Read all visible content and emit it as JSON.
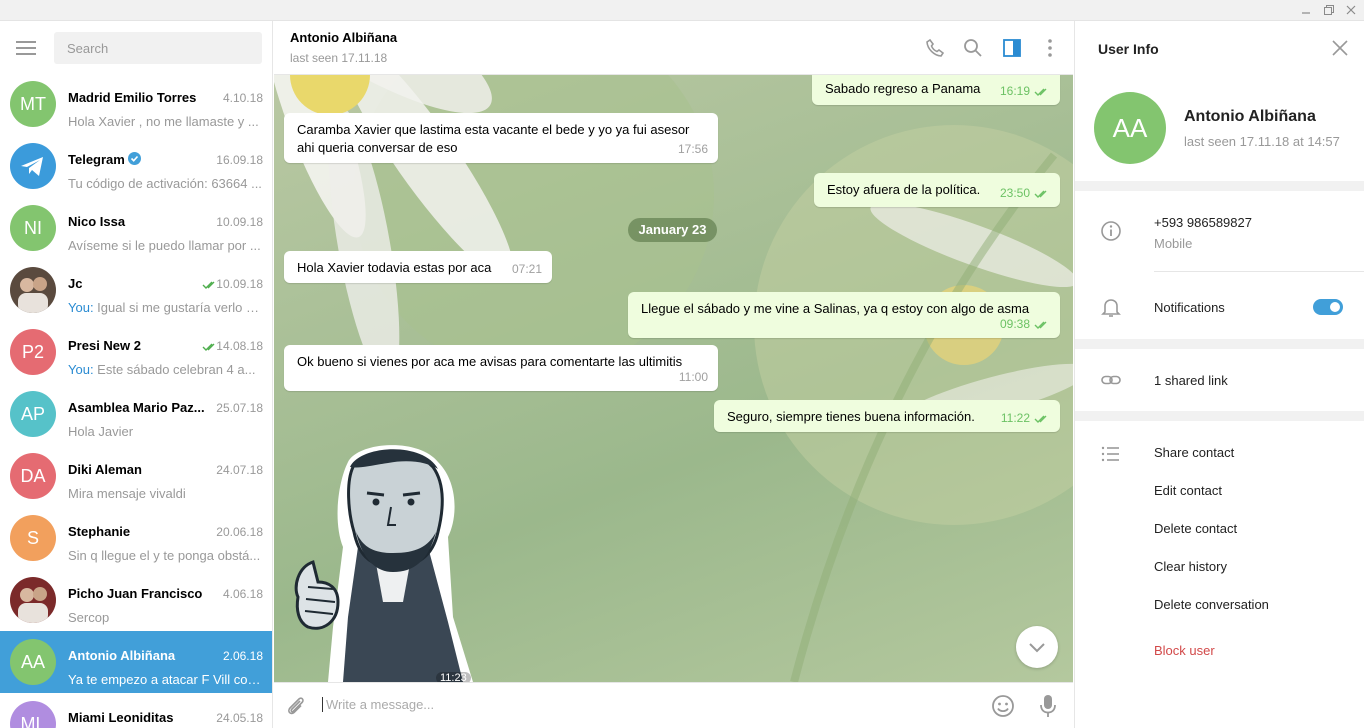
{
  "window": {
    "minimize_icon": "minimize-icon",
    "maximize_icon": "restore-icon",
    "close_icon": "close-icon"
  },
  "sidebar": {
    "search_placeholder": "Search",
    "chats": [
      {
        "initials": "MT",
        "color": "#83c56f",
        "name": "Madrid Emilio Torres",
        "date": "4.10.18",
        "preview": "Hola Xavier , no me llamaste y ...",
        "you": ""
      },
      {
        "initials": "",
        "color": "#3b9bdb",
        "name": "Telegram",
        "verified": true,
        "date": "16.09.18",
        "preview": "Tu código de activación: 63664 ...",
        "you": ""
      },
      {
        "initials": "NI",
        "color": "#83c56f",
        "name": "Nico Issa",
        "date": "10.09.18",
        "preview": "Avíseme si le puedo llamar por ...",
        "you": ""
      },
      {
        "initials": "",
        "color": "#5a4a3e",
        "name": "Jc",
        "date": "10.09.18",
        "read": true,
        "preview": "Igual si me gustaría verlo s...",
        "you": "You: "
      },
      {
        "initials": "P2",
        "color": "#e56b72",
        "name": "Presi New 2",
        "date": "14.08.18",
        "read": true,
        "preview": "Este sábado celebran 4 a...",
        "you": "You: "
      },
      {
        "initials": "AP",
        "color": "#56c2c9",
        "name": "Asamblea Mario Paz...",
        "date": "25.07.18",
        "preview": "Hola Javier",
        "you": ""
      },
      {
        "initials": "DA",
        "color": "#e56b72",
        "name": "Diki Aleman",
        "date": "24.07.18",
        "preview": "Mira mensaje vivaldi",
        "you": ""
      },
      {
        "initials": "S",
        "color": "#f2a05d",
        "name": "Stephanie",
        "date": "20.06.18",
        "preview": "Sin q llegue el y te ponga obstá...",
        "you": ""
      },
      {
        "initials": "",
        "color": "#7b2a2a",
        "name": "Picho Juan Francisco",
        "date": "4.06.18",
        "preview": "Sercop",
        "you": ""
      },
      {
        "initials": "AA",
        "color": "#83c56f",
        "name": "Antonio Albiñana",
        "date": "2.06.18",
        "preview": "Ya te empezo a atacar F Vill con...",
        "you": "",
        "active": true
      },
      {
        "initials": "ML",
        "color": "#b08de0",
        "name": "Miami Leoniditas",
        "date": "24.05.18",
        "preview": "",
        "you": ""
      }
    ]
  },
  "chat": {
    "name": "Antonio Albiñana",
    "status": "last seen 17.11.18",
    "date_separator": "January 23",
    "messages": [
      {
        "text": "Sabado regreso a Panama",
        "time": "16:19",
        "out": true
      },
      {
        "text": "Caramba Xavier que lastima esta vacante el bede y yo ya fui asesor ahi queria conversar de eso",
        "time": "17:56",
        "out": false
      },
      {
        "text": "Estoy afuera de la política.",
        "time": "23:50",
        "out": true
      },
      {
        "text": "Hola Xavier todavia estas por aca",
        "time": "07:21",
        "out": false
      },
      {
        "text": "Llegue el sábado y me vine a Salinas, ya q estoy con algo de asma",
        "time": "09:38",
        "out": true
      },
      {
        "text": "Ok bueno si vienes por aca me avisas para comentarte las ultimitis",
        "time": "11:00",
        "out": false
      },
      {
        "text": "Seguro, siempre tienes buena información.",
        "time": "11:22",
        "out": true
      }
    ],
    "sticker_time": "11:23",
    "composer_placeholder": "Write a message..."
  },
  "info": {
    "title": "User Info",
    "initials": "AA",
    "name": "Antonio Albiñana",
    "seen": "last seen 17.11.18 at 14:57",
    "phone": "+593 986589827",
    "phone_label": "Mobile",
    "notifications": "Notifications",
    "notifications_on": true,
    "shared_links": "1 shared link",
    "actions": [
      "Share contact",
      "Edit contact",
      "Delete contact",
      "Clear history",
      "Delete conversation"
    ],
    "block": "Block user"
  }
}
